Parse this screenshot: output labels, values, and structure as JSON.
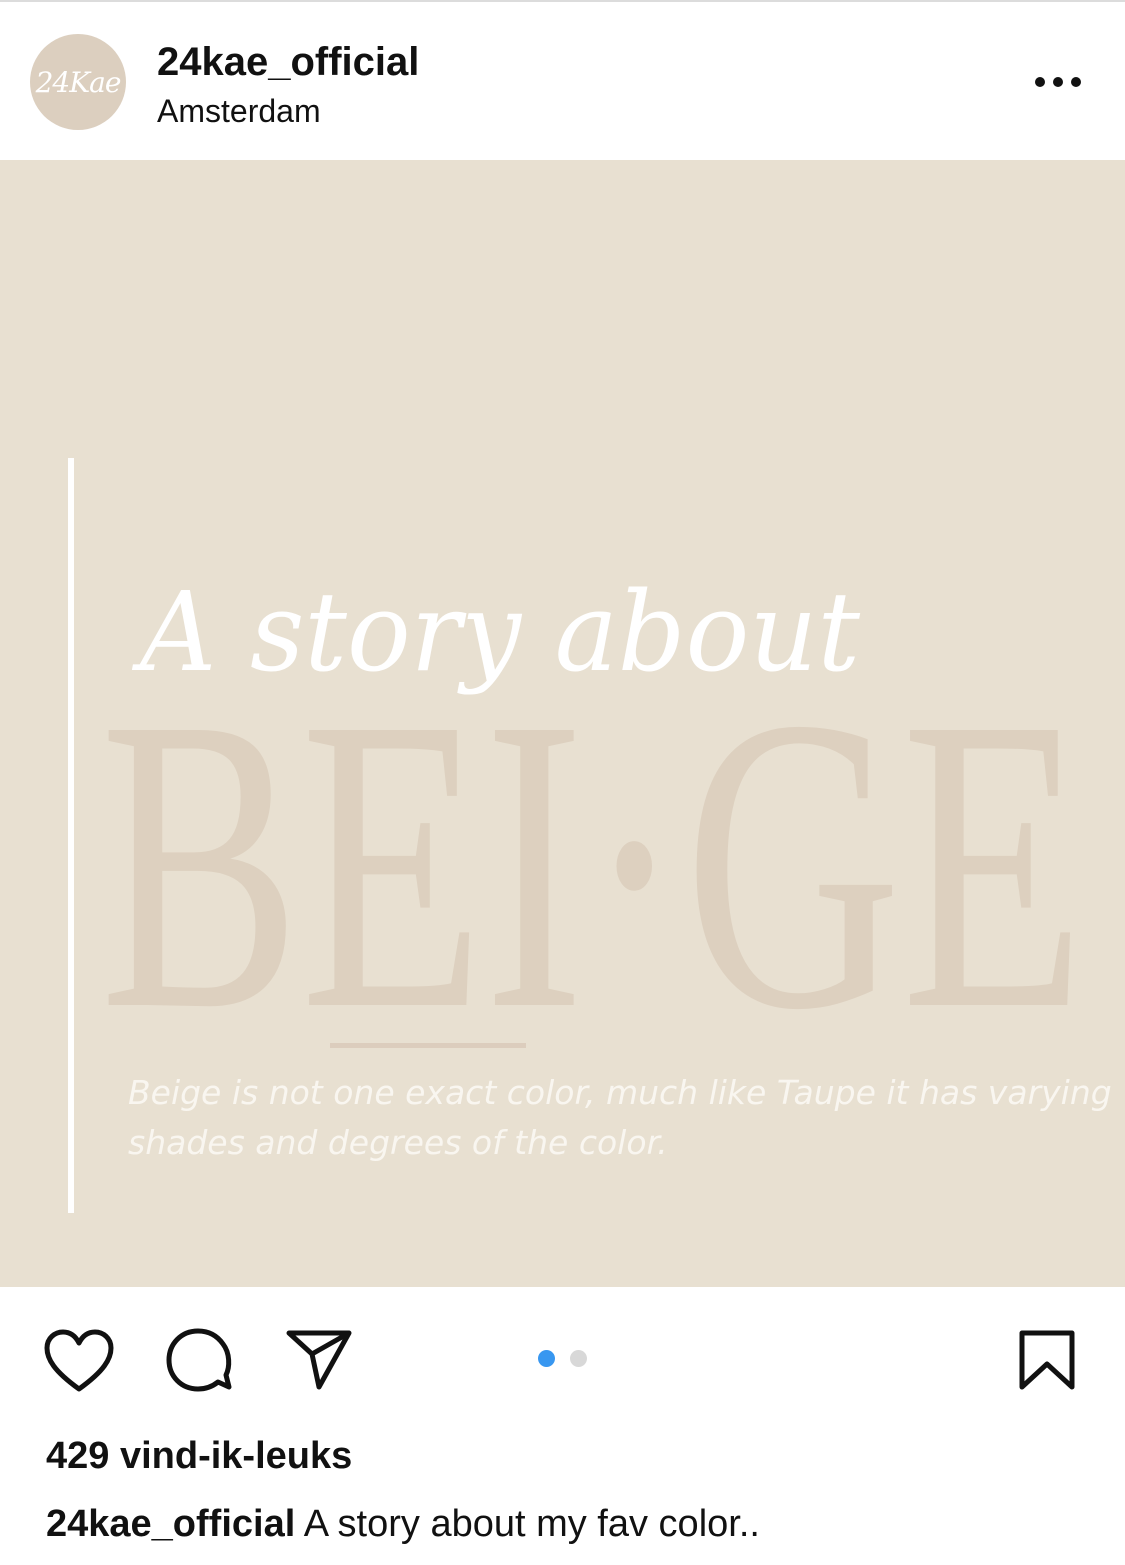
{
  "post": {
    "username": "24kae_official",
    "location": "Amsterdam",
    "avatar_text": "24Kae",
    "more_icon": "more-horizontal-icon",
    "image": {
      "script_title": "A story about",
      "big_word": "BEI·GE",
      "description": "Beige is not one exact color, much like Taupe it has varying shades and degrees of the color.",
      "colors": {
        "background": "#e8e0d1",
        "big_word": "#ddd0bf",
        "text_light": "#ffffff"
      }
    },
    "actions": {
      "like_icon": "heart-icon",
      "comment_icon": "comment-icon",
      "share_icon": "send-icon",
      "save_icon": "bookmark-icon"
    },
    "carousel": {
      "total": 2,
      "active": 1,
      "active_color": "#3897f0",
      "inactive_color": "#d8d8d8"
    },
    "likes": "429 vind-ik-leuks",
    "caption": {
      "username": "24kae_official",
      "text": "A story about my fav color.."
    }
  }
}
